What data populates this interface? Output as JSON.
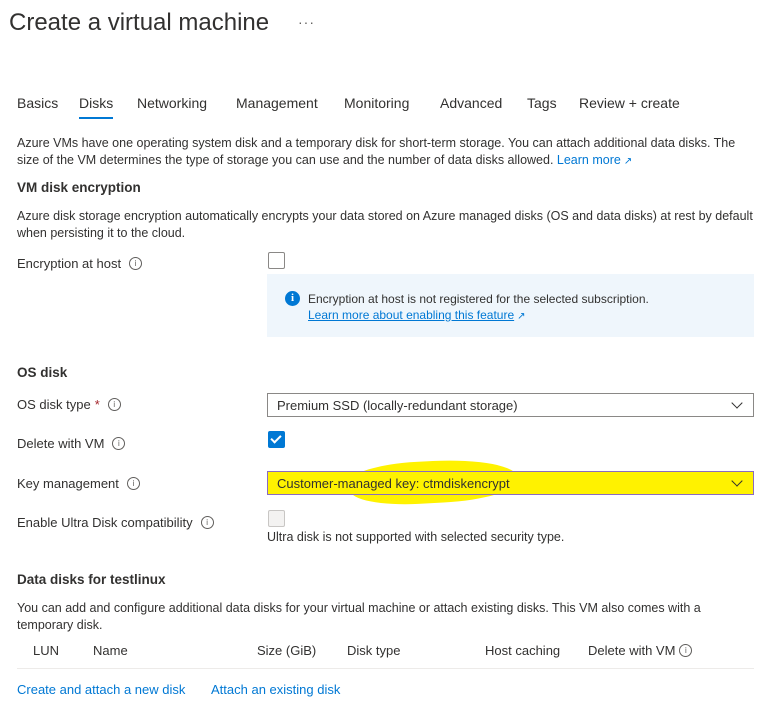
{
  "header": {
    "title": "Create a virtual machine",
    "more": "···"
  },
  "tabs": [
    {
      "label": "Basics"
    },
    {
      "label": "Disks"
    },
    {
      "label": "Networking"
    },
    {
      "label": "Management"
    },
    {
      "label": "Monitoring"
    },
    {
      "label": "Advanced"
    },
    {
      "label": "Tags"
    },
    {
      "label": "Review + create"
    }
  ],
  "active_tab": "Disks",
  "intro": {
    "text": "Azure VMs have one operating system disk and a temporary disk for short-term storage. You can attach additional data disks. The size of the VM determines the type of storage you can use and the number of data disks allowed.",
    "link": "Learn more"
  },
  "encryption": {
    "heading": "VM disk encryption",
    "description": "Azure disk storage encryption automatically encrypts your data stored on Azure managed disks (OS and data disks) at rest by default when persisting it to the cloud.",
    "host_label": "Encryption at host",
    "host_checked": false,
    "notice_text": "Encryption at host is not registered for the selected subscription.",
    "notice_link": "Learn more about enabling this feature"
  },
  "os_disk": {
    "heading": "OS disk",
    "type_label": "OS disk type",
    "required_mark": "*",
    "type_value": "Premium SSD (locally-redundant storage)",
    "delete_label": "Delete with VM",
    "delete_checked": true,
    "key_label": "Key management",
    "key_value": "Customer-managed key: ctmdiskencrypt",
    "ultra_label": "Enable Ultra Disk compatibility",
    "ultra_checked": false,
    "ultra_note": "Ultra disk is not supported with selected security type."
  },
  "data_disks": {
    "heading": "Data disks for testlinux",
    "description": "You can add and configure additional data disks for your virtual machine or attach existing disks. This VM also comes with a temporary disk.",
    "columns": [
      "LUN",
      "Name",
      "Size (GiB)",
      "Disk type",
      "Host caching",
      "Delete with VM"
    ],
    "create_link": "Create and attach a new disk",
    "attach_link": "Attach an existing disk"
  },
  "colors": {
    "accent": "#0078d4",
    "highlight": "#fff200",
    "info_background": "#eff6fc"
  },
  "icons": [
    "ellipsis-icon",
    "info-icon",
    "external-link-icon",
    "info-filled-icon",
    "chevron-down-icon",
    "checkmark-icon"
  ]
}
